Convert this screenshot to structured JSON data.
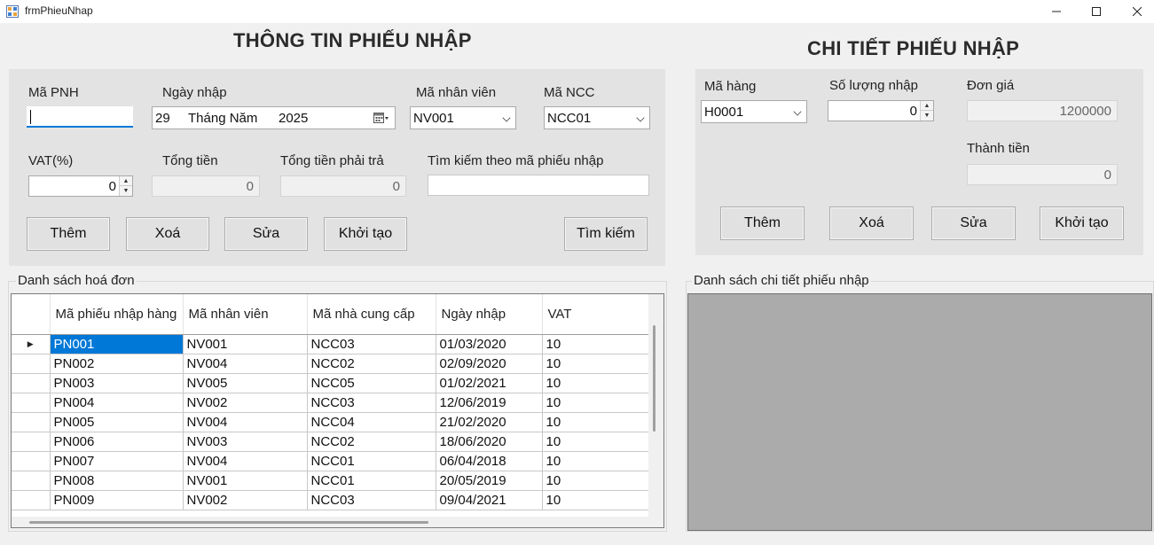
{
  "window": {
    "title": "frmPhieuNhap"
  },
  "receipt_info": {
    "heading": "THÔNG TIN PHIẾU NHẬP",
    "ma_pnh_label": "Mã PNH",
    "ma_pnh_value": "",
    "ngay_nhap_label": "Ngày nhập",
    "ngay_nhap_day": "29",
    "ngay_nhap_month": "Tháng Năm",
    "ngay_nhap_year": "2025",
    "ma_nhan_vien_label": "Mã nhân viên",
    "ma_nhan_vien_value": "NV001",
    "ma_ncc_label": "Mã NCC",
    "ma_ncc_value": "NCC01",
    "vat_label": "VAT(%)",
    "vat_value": "0",
    "tong_tien_label": "Tổng tiền",
    "tong_tien_value": "0",
    "tong_tien_phai_tra_label": "Tổng tiền phải trả",
    "tong_tien_phai_tra_value": "0",
    "tim_kiem_label": "Tìm kiếm theo mã phiếu nhập",
    "tim_kiem_value": "",
    "buttons": {
      "them": "Thêm",
      "xoa": "Xoá",
      "sua": "Sửa",
      "khoi_tao": "Khởi tạo",
      "tim_kiem": "Tìm kiếm"
    }
  },
  "receipt_detail": {
    "heading": "CHI TIẾT PHIẾU NHẬP",
    "ma_hang_label": "Mã hàng",
    "ma_hang_value": "H0001",
    "so_luong_label": "Số lượng nhập",
    "so_luong_value": "0",
    "don_gia_label": "Đơn giá",
    "don_gia_value": "1200000",
    "thanh_tien_label": "Thành tiền",
    "thanh_tien_value": "0",
    "buttons": {
      "them": "Thêm",
      "xoa": "Xoá",
      "sua": "Sửa",
      "khoi_tao": "Khởi tạo"
    }
  },
  "invoice_list": {
    "group_label": "Danh sách hoá đơn",
    "columns": [
      "Mã phiếu nhập hàng",
      "Mã nhân viên",
      "Mã nhà cung cấp",
      "Ngày nhập",
      "VAT"
    ],
    "rows": [
      [
        "PN001",
        "NV001",
        "NCC03",
        "01/03/2020",
        "10"
      ],
      [
        "PN002",
        "NV004",
        "NCC02",
        "02/09/2020",
        "10"
      ],
      [
        "PN003",
        "NV005",
        "NCC05",
        "01/02/2021",
        "10"
      ],
      [
        "PN004",
        "NV002",
        "NCC03",
        "12/06/2019",
        "10"
      ],
      [
        "PN005",
        "NV004",
        "NCC04",
        "21/02/2020",
        "10"
      ],
      [
        "PN006",
        "NV003",
        "NCC02",
        "18/06/2020",
        "10"
      ],
      [
        "PN007",
        "NV004",
        "NCC01",
        "06/04/2018",
        "10"
      ],
      [
        "PN008",
        "NV001",
        "NCC01",
        "20/05/2019",
        "10"
      ],
      [
        "PN009",
        "NV002",
        "NCC03",
        "09/04/2021",
        "10"
      ]
    ],
    "current_row_marker": "▶"
  },
  "detail_list": {
    "group_label": "Danh sách chi tiết phiếu nhập"
  }
}
